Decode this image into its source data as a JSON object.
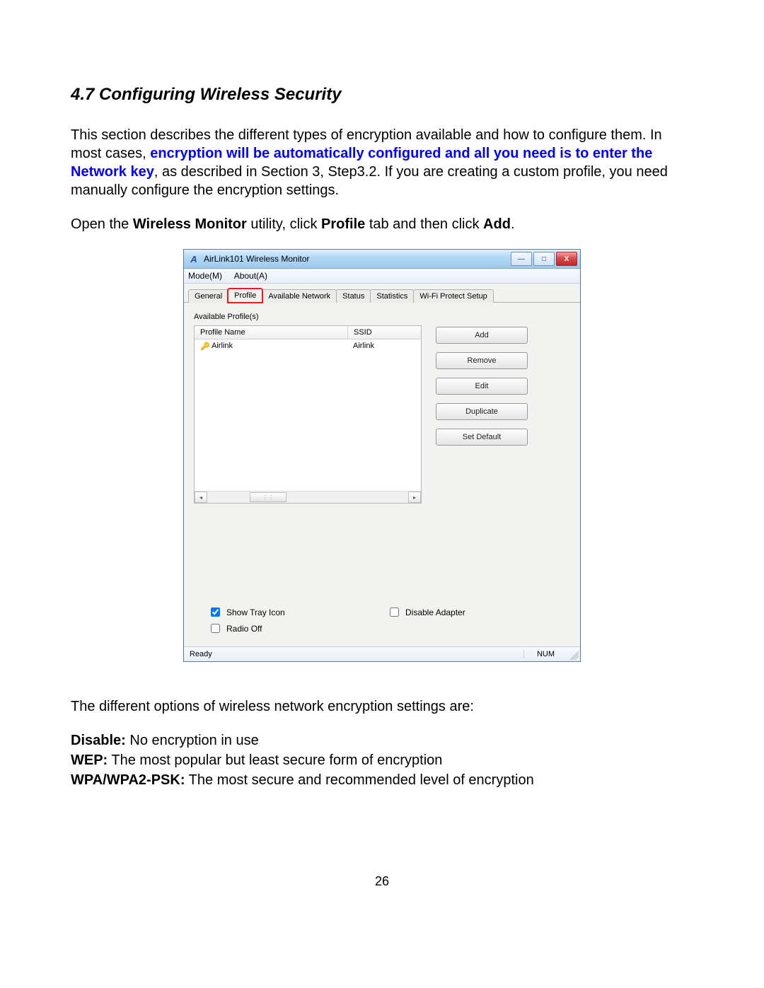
{
  "heading": "4.7 Configuring Wireless Security",
  "para1_a": "This section describes the different types of encryption available and how to configure them. In most cases, ",
  "para1_blue": "encryption will be automatically configured and all you need is to enter the Network key",
  "para1_b": ", as described in Section 3, Step3.2. If you are creating a custom profile, you need manually configure the encryption settings.",
  "para2_a": "Open the ",
  "para2_b": "Wireless Monitor",
  "para2_c": " utility, click ",
  "para2_d": "Profile",
  "para2_e": " tab and then click ",
  "para2_f": "Add",
  "para2_g": ".",
  "app": {
    "title": "AirLink101 Wireless Monitor",
    "icon_glyph": "A",
    "menu": {
      "mode": "Mode(M)",
      "about": "About(A)"
    },
    "tabs": {
      "general": "General",
      "profile": "Profile",
      "available": "Available Network",
      "status": "Status",
      "statistics": "Statistics",
      "wps": "Wi-Fi Protect Setup"
    },
    "panel_label": "Available Profile(s)",
    "columns": {
      "name": "Profile Name",
      "ssid": "SSID"
    },
    "rows": [
      {
        "name": "Airlink",
        "ssid": "Airlink"
      }
    ],
    "buttons": {
      "add": "Add",
      "remove": "Remove",
      "edit": "Edit",
      "duplicate": "Duplicate",
      "set_default": "Set Default"
    },
    "checks": {
      "show_tray": "Show Tray Icon",
      "disable_adapter": "Disable Adapter",
      "radio_off": "Radio Off"
    },
    "status": {
      "ready": "Ready",
      "num": "NUM"
    }
  },
  "para3": "The different options of wireless network encryption settings are:",
  "opts": {
    "disable_k": "Disable:",
    "disable_v": "  No encryption in use",
    "wep_k": "WEP:",
    "wep_v": "  The most popular but least secure form of encryption",
    "wpa_k": "WPA/WPA2-PSK:",
    "wpa_v": "  The most secure and recommended level of encryption"
  },
  "page_number": "26"
}
